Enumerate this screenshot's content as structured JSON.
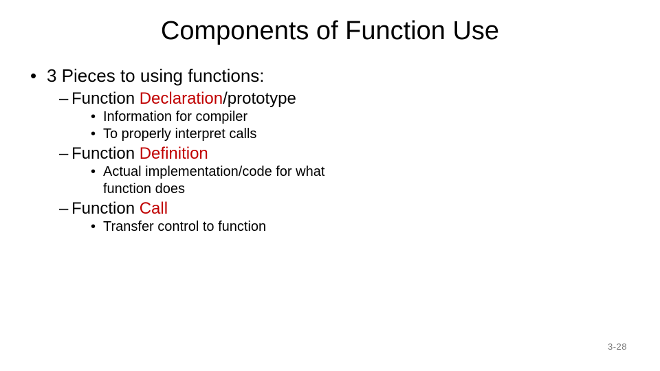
{
  "title": "Components of Function Use",
  "lvl1": {
    "text": "3 Pieces to using functions:"
  },
  "sec1": {
    "prefix": "Function ",
    "red": "Declaration",
    "suffix": "/prototype",
    "b1": "Information for compiler",
    "b2": "To properly interpret calls"
  },
  "sec2": {
    "prefix": "Function ",
    "red": "Definition",
    "b1": "Actual implementation/code for what",
    "b1b": "function does"
  },
  "sec3": {
    "prefix": "Function ",
    "red": "Call",
    "b1": "Transfer control to function"
  },
  "pagenum": "3-28"
}
